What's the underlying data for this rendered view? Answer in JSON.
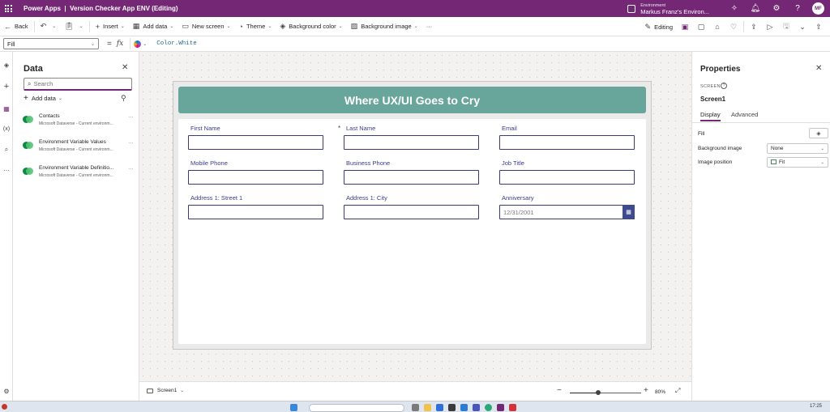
{
  "titlebar": {
    "app_name": "Power Apps",
    "separator": "|",
    "doc_title": "Version Checker App ENV (Editing)",
    "environment_caption": "Environment",
    "environment_name": "Markus Franz's Environ...",
    "user_initials": "MF"
  },
  "commandbar": {
    "back": "Back",
    "insert": "Insert",
    "add_data": "Add data",
    "new_screen": "New screen",
    "theme": "Theme",
    "background_color": "Background color",
    "background_image": "Background image",
    "more": "···",
    "editing": "Editing"
  },
  "formulabar": {
    "property": "Fill",
    "equals": "=",
    "fx": "fx",
    "formula": "Color.White"
  },
  "data_pane": {
    "title": "Data",
    "search_placeholder": "Search",
    "add_data": "Add data",
    "items": [
      {
        "name": "Contacts",
        "source": "Microsoft Dataverse - Current environm..."
      },
      {
        "name": "Environment Variable Values",
        "source": "Microsoft Dataverse - Current environm..."
      },
      {
        "name": "Environment Variable Definitio...",
        "source": "Microsoft Dataverse - Current environm..."
      }
    ]
  },
  "app": {
    "header": "Where UX/UI Goes to Cry",
    "required_marker": "*",
    "fields": [
      {
        "label": "First Name",
        "value": ""
      },
      {
        "label": "Last Name",
        "value": ""
      },
      {
        "label": "Email",
        "value": ""
      },
      {
        "label": "Mobile Phone",
        "value": ""
      },
      {
        "label": "Business Phone",
        "value": ""
      },
      {
        "label": "Job Title",
        "value": ""
      },
      {
        "label": "Address 1: Street 1",
        "value": ""
      },
      {
        "label": "Address 1: City",
        "value": ""
      },
      {
        "label": "Anniversary",
        "value": "12/31/2001"
      }
    ]
  },
  "statusbar": {
    "screen_name": "Screen1",
    "zoom_minus": "−",
    "zoom_plus": "+",
    "zoom": "80%",
    "zoom_fraction": 0.4
  },
  "properties": {
    "title": "Properties",
    "kind": "SCREEN",
    "name": "Screen1",
    "tabs": [
      "Display",
      "Advanced"
    ],
    "rows": [
      {
        "label": "Fill",
        "value": ""
      },
      {
        "label": "Background image",
        "value": "None"
      },
      {
        "label": "Image position",
        "value": "Fit"
      }
    ]
  },
  "taskbar": {
    "time": "17:25"
  },
  "colors": {
    "brand": "#742774",
    "header_bar": "#68a59a",
    "field_border": "#3b3a7a",
    "calendar_button": "#3f4a8f"
  }
}
